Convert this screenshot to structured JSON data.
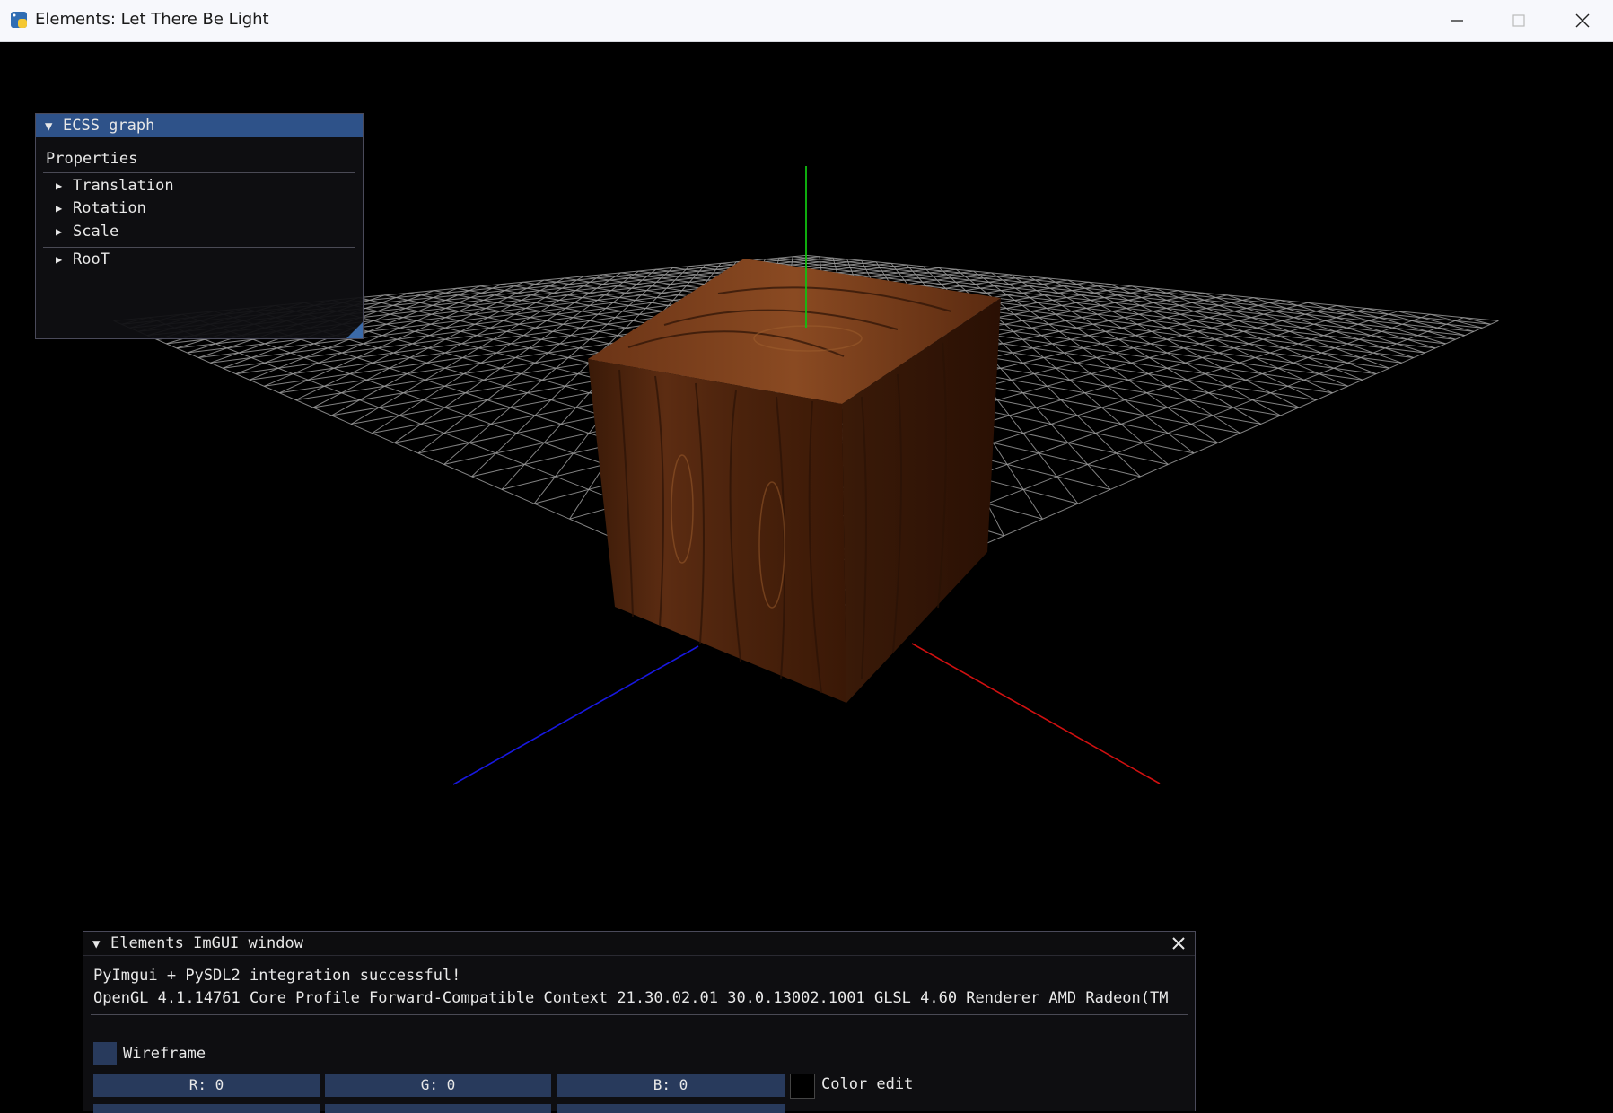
{
  "window": {
    "title": "Elements: Let There Be Light",
    "app_icon": "python-icon"
  },
  "ecss_graph": {
    "title": "ECSS graph",
    "section": "Properties",
    "items": [
      "Translation",
      "Rotation",
      "Scale"
    ],
    "root": "RooT"
  },
  "imgui_window": {
    "title": "Elements ImGUI window",
    "line1": "PyImgui + PySDL2 integration successful!",
    "line2": "OpenGL 4.1.14761 Core Profile Forward-Compatible Context 21.30.02.01 30.0.13002.1001 GLSL 4.60 Renderer AMD Radeon(TM",
    "wireframe_label": "Wireframe",
    "wireframe_checked": false,
    "r_label": "R:  0",
    "g_label": "G:  0",
    "b_label": "B:  0",
    "color_edit_label": "Color edit"
  },
  "colors": {
    "imgui_title_active": "#2e5289",
    "frame_bg": "#283a5c",
    "grid": "#9a9a9a",
    "axis_x": "#d01010",
    "axis_y": "#10c010",
    "axis_z": "#1818e0",
    "wood": "#5a2a12"
  }
}
